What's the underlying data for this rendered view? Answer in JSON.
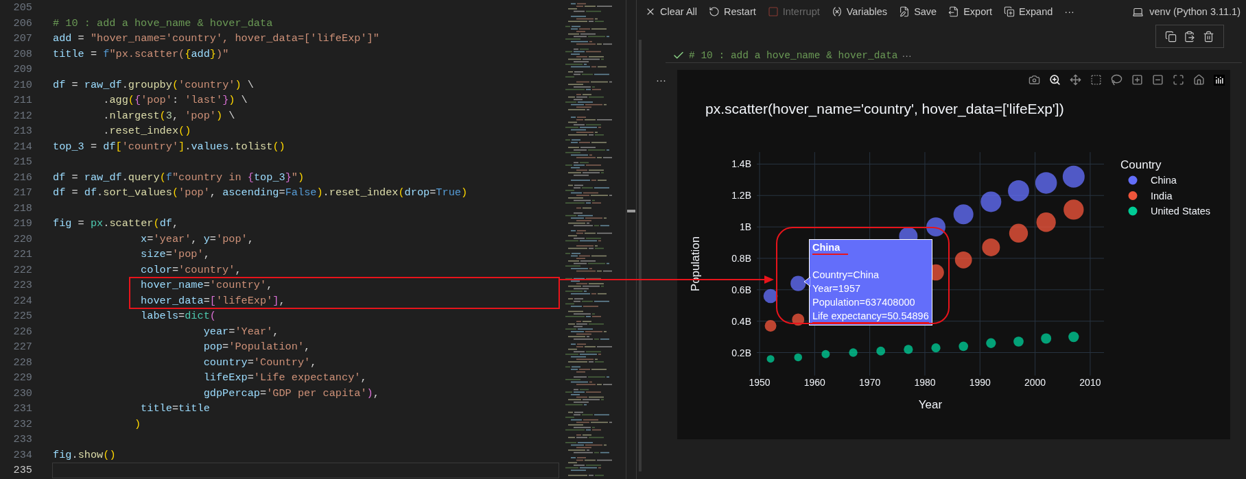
{
  "editor": {
    "lines": [
      {
        "number": "205",
        "current": false,
        "boxed": false
      },
      {
        "number": "206",
        "current": false,
        "boxed": false,
        "tokens": [
          {
            "text": "# 10 : add a hove_name & hover_data",
            "kind": "comment"
          }
        ]
      },
      {
        "number": "207",
        "current": false,
        "boxed": false,
        "tokens": [
          {
            "text": "add",
            "kind": "var"
          },
          {
            "text": " = ",
            "kind": "punct"
          },
          {
            "text": "\"hover_name='country', hover_data=['lifeExp']\"",
            "kind": "str"
          }
        ]
      },
      {
        "number": "208",
        "current": false,
        "boxed": false,
        "tokens": [
          {
            "text": "title",
            "kind": "var"
          },
          {
            "text": " = ",
            "kind": "punct"
          },
          {
            "text": "f",
            "kind": "const"
          },
          {
            "text": "\"px.scatter(",
            "kind": "str"
          },
          {
            "text": "{",
            "kind": "bracket1"
          },
          {
            "text": "add",
            "kind": "var"
          },
          {
            "text": "}",
            "kind": "bracket1"
          },
          {
            "text": ")\"",
            "kind": "str"
          }
        ]
      },
      {
        "number": "209",
        "current": false,
        "boxed": false
      },
      {
        "number": "210",
        "current": false,
        "boxed": false,
        "tokens": [
          {
            "text": "df",
            "kind": "var"
          },
          {
            "text": " = ",
            "kind": "punct"
          },
          {
            "text": "raw_df",
            "kind": "var"
          },
          {
            "text": ".",
            "kind": "punct"
          },
          {
            "text": "groupby",
            "kind": "func"
          },
          {
            "text": "(",
            "kind": "bracket1"
          },
          {
            "text": "'country'",
            "kind": "str"
          },
          {
            "text": ")",
            "kind": "bracket1"
          },
          {
            "text": " \\",
            "kind": "punct"
          }
        ]
      },
      {
        "number": "211",
        "current": false,
        "boxed": false,
        "tokens": [
          {
            "text": "        .",
            "kind": "punct"
          },
          {
            "text": "agg",
            "kind": "func"
          },
          {
            "text": "(",
            "kind": "bracket1"
          },
          {
            "text": "{",
            "kind": "bracket2"
          },
          {
            "text": "'pop'",
            "kind": "str"
          },
          {
            "text": ": ",
            "kind": "punct"
          },
          {
            "text": "'last'",
            "kind": "str"
          },
          {
            "text": "}",
            "kind": "bracket2"
          },
          {
            "text": ")",
            "kind": "bracket1"
          },
          {
            "text": " \\",
            "kind": "punct"
          }
        ]
      },
      {
        "number": "212",
        "current": false,
        "boxed": false,
        "tokens": [
          {
            "text": "        .",
            "kind": "punct"
          },
          {
            "text": "nlargest",
            "kind": "func"
          },
          {
            "text": "(",
            "kind": "bracket1"
          },
          {
            "text": "3",
            "kind": "number"
          },
          {
            "text": ", ",
            "kind": "punct"
          },
          {
            "text": "'pop'",
            "kind": "str"
          },
          {
            "text": ")",
            "kind": "bracket1"
          },
          {
            "text": " \\",
            "kind": "punct"
          }
        ]
      },
      {
        "number": "213",
        "current": false,
        "boxed": false,
        "tokens": [
          {
            "text": "        .",
            "kind": "punct"
          },
          {
            "text": "reset_index",
            "kind": "func"
          },
          {
            "text": "()",
            "kind": "bracket1"
          }
        ]
      },
      {
        "number": "214",
        "current": false,
        "boxed": false,
        "tokens": [
          {
            "text": "top_3",
            "kind": "var"
          },
          {
            "text": " = ",
            "kind": "punct"
          },
          {
            "text": "df",
            "kind": "var"
          },
          {
            "text": "[",
            "kind": "bracket1"
          },
          {
            "text": "'country'",
            "kind": "str"
          },
          {
            "text": "]",
            "kind": "bracket1"
          },
          {
            "text": ".",
            "kind": "punct"
          },
          {
            "text": "values",
            "kind": "var"
          },
          {
            "text": ".",
            "kind": "punct"
          },
          {
            "text": "tolist",
            "kind": "func"
          },
          {
            "text": "()",
            "kind": "bracket1"
          }
        ]
      },
      {
        "number": "215",
        "current": false,
        "boxed": false
      },
      {
        "number": "216",
        "current": false,
        "boxed": false,
        "tokens": [
          {
            "text": "df",
            "kind": "var"
          },
          {
            "text": " = ",
            "kind": "punct"
          },
          {
            "text": "raw_df",
            "kind": "var"
          },
          {
            "text": ".",
            "kind": "punct"
          },
          {
            "text": "query",
            "kind": "func"
          },
          {
            "text": "(",
            "kind": "bracket1"
          },
          {
            "text": "f",
            "kind": "const"
          },
          {
            "text": "\"country in ",
            "kind": "str"
          },
          {
            "text": "{",
            "kind": "bracket2"
          },
          {
            "text": "top_3",
            "kind": "var"
          },
          {
            "text": "}",
            "kind": "bracket2"
          },
          {
            "text": "\"",
            "kind": "str"
          },
          {
            "text": ")",
            "kind": "bracket1"
          }
        ]
      },
      {
        "number": "217",
        "current": false,
        "boxed": false,
        "tokens": [
          {
            "text": "df",
            "kind": "var"
          },
          {
            "text": " = ",
            "kind": "punct"
          },
          {
            "text": "df",
            "kind": "var"
          },
          {
            "text": ".",
            "kind": "punct"
          },
          {
            "text": "sort_values",
            "kind": "func"
          },
          {
            "text": "(",
            "kind": "bracket1"
          },
          {
            "text": "'pop'",
            "kind": "str"
          },
          {
            "text": ", ",
            "kind": "punct"
          },
          {
            "text": "ascending",
            "kind": "var"
          },
          {
            "text": "=",
            "kind": "punct"
          },
          {
            "text": "False",
            "kind": "const"
          },
          {
            "text": ")",
            "kind": "bracket1"
          },
          {
            "text": ".",
            "kind": "punct"
          },
          {
            "text": "reset_index",
            "kind": "func"
          },
          {
            "text": "(",
            "kind": "bracket1"
          },
          {
            "text": "drop",
            "kind": "var"
          },
          {
            "text": "=",
            "kind": "punct"
          },
          {
            "text": "True",
            "kind": "const"
          },
          {
            "text": ")",
            "kind": "bracket1"
          }
        ]
      },
      {
        "number": "218",
        "current": false,
        "boxed": false
      },
      {
        "number": "219",
        "current": false,
        "boxed": false,
        "tokens": [
          {
            "text": "fig",
            "kind": "var"
          },
          {
            "text": " = ",
            "kind": "punct"
          },
          {
            "text": "px",
            "kind": "module"
          },
          {
            "text": ".",
            "kind": "punct"
          },
          {
            "text": "scatter",
            "kind": "func"
          },
          {
            "text": "(",
            "kind": "bracket1"
          },
          {
            "text": "df",
            "kind": "var"
          },
          {
            "text": ",",
            "kind": "punct"
          }
        ]
      },
      {
        "number": "220",
        "current": false,
        "boxed": false,
        "tokens": [
          {
            "text": "              x",
            "kind": "var"
          },
          {
            "text": "=",
            "kind": "punct"
          },
          {
            "text": "'year'",
            "kind": "str"
          },
          {
            "text": ", ",
            "kind": "punct"
          },
          {
            "text": "y",
            "kind": "var"
          },
          {
            "text": "=",
            "kind": "punct"
          },
          {
            "text": "'pop'",
            "kind": "str"
          },
          {
            "text": ",",
            "kind": "punct"
          }
        ]
      },
      {
        "number": "221",
        "current": false,
        "boxed": false,
        "tokens": [
          {
            "text": "              size",
            "kind": "var"
          },
          {
            "text": "=",
            "kind": "punct"
          },
          {
            "text": "'pop'",
            "kind": "str"
          },
          {
            "text": ",",
            "kind": "punct"
          }
        ]
      },
      {
        "number": "222",
        "current": false,
        "boxed": false,
        "tokens": [
          {
            "text": "              color",
            "kind": "var"
          },
          {
            "text": "=",
            "kind": "punct"
          },
          {
            "text": "'country'",
            "kind": "str"
          },
          {
            "text": ",",
            "kind": "punct"
          }
        ]
      },
      {
        "number": "223",
        "current": false,
        "boxed": true,
        "tokens": [
          {
            "text": "              hover_name",
            "kind": "var"
          },
          {
            "text": "=",
            "kind": "punct"
          },
          {
            "text": "'country'",
            "kind": "str"
          },
          {
            "text": ",",
            "kind": "punct"
          }
        ]
      },
      {
        "number": "224",
        "current": false,
        "boxed": true,
        "tokens": [
          {
            "text": "              hover_data",
            "kind": "var"
          },
          {
            "text": "=",
            "kind": "punct"
          },
          {
            "text": "[",
            "kind": "bracket2"
          },
          {
            "text": "'lifeExp'",
            "kind": "str"
          },
          {
            "text": "]",
            "kind": "bracket2"
          },
          {
            "text": ",",
            "kind": "punct"
          }
        ]
      },
      {
        "number": "225",
        "current": false,
        "boxed": false,
        "tokens": [
          {
            "text": "              labels",
            "kind": "var"
          },
          {
            "text": "=",
            "kind": "punct"
          },
          {
            "text": "dict",
            "kind": "module"
          },
          {
            "text": "(",
            "kind": "bracket2"
          }
        ]
      },
      {
        "number": "226",
        "current": false,
        "boxed": false,
        "tokens": [
          {
            "text": "                        year",
            "kind": "var"
          },
          {
            "text": "=",
            "kind": "punct"
          },
          {
            "text": "'Year'",
            "kind": "str"
          },
          {
            "text": ",",
            "kind": "punct"
          }
        ]
      },
      {
        "number": "227",
        "current": false,
        "boxed": false,
        "tokens": [
          {
            "text": "                        pop",
            "kind": "var"
          },
          {
            "text": "=",
            "kind": "punct"
          },
          {
            "text": "'Population'",
            "kind": "str"
          },
          {
            "text": ",",
            "kind": "punct"
          }
        ]
      },
      {
        "number": "228",
        "current": false,
        "boxed": false,
        "tokens": [
          {
            "text": "                        country",
            "kind": "var"
          },
          {
            "text": "=",
            "kind": "punct"
          },
          {
            "text": "'Country'",
            "kind": "str"
          },
          {
            "text": ",",
            "kind": "punct"
          }
        ]
      },
      {
        "number": "229",
        "current": false,
        "boxed": false,
        "tokens": [
          {
            "text": "                        lifeExp",
            "kind": "var"
          },
          {
            "text": "=",
            "kind": "punct"
          },
          {
            "text": "'Life expectancy'",
            "kind": "str"
          },
          {
            "text": ",",
            "kind": "punct"
          }
        ]
      },
      {
        "number": "230",
        "current": false,
        "boxed": false,
        "tokens": [
          {
            "text": "                        gdpPercap",
            "kind": "var"
          },
          {
            "text": "=",
            "kind": "punct"
          },
          {
            "text": "'GDP per capita'",
            "kind": "str"
          },
          {
            "text": ")",
            "kind": "bracket2"
          },
          {
            "text": ",",
            "kind": "punct"
          }
        ]
      },
      {
        "number": "231",
        "current": false,
        "boxed": false,
        "tokens": [
          {
            "text": "              title",
            "kind": "var"
          },
          {
            "text": "=",
            "kind": "punct"
          },
          {
            "text": "title",
            "kind": "var"
          }
        ]
      },
      {
        "number": "232",
        "current": false,
        "boxed": false,
        "tokens": [
          {
            "text": "             )",
            "kind": "bracket1"
          }
        ]
      },
      {
        "number": "233",
        "current": false,
        "boxed": false
      },
      {
        "number": "234",
        "current": false,
        "boxed": false,
        "tokens": [
          {
            "text": "fig",
            "kind": "var"
          },
          {
            "text": ".",
            "kind": "punct"
          },
          {
            "text": "show",
            "kind": "func"
          },
          {
            "text": "()",
            "kind": "bracket1"
          }
        ]
      },
      {
        "number": "235",
        "current": true,
        "boxed": false
      }
    ]
  },
  "toolbar": {
    "buttons": [
      {
        "kind": "clear",
        "label": "Clear All",
        "disabled": false
      },
      {
        "kind": "restart",
        "label": "Restart",
        "disabled": false
      },
      {
        "kind": "interrupt",
        "label": "Interrupt",
        "disabled": true
      },
      {
        "kind": "variables",
        "label": "Variables",
        "disabled": false
      },
      {
        "kind": "save",
        "label": "Save",
        "disabled": false
      },
      {
        "kind": "export",
        "label": "Export",
        "disabled": false
      },
      {
        "kind": "expand",
        "label": "Expand",
        "disabled": false
      },
      {
        "kind": "more",
        "label": "···",
        "disabled": false
      }
    ],
    "kernel": "venv (Python 3.11.1)"
  },
  "cell": {
    "succeeded": true,
    "summary": "# 10 : add a hove_name & hover_data",
    "summary_more": "···",
    "output_menu": "···"
  },
  "plot": {
    "chart_data": {
      "type": "scatter",
      "title": "px.scatter(hover_name='country', hover_data=['lifeExp'])",
      "xlabel": "Year",
      "ylabel": "Population",
      "x": [
        1952,
        1957,
        1962,
        1967,
        1972,
        1977,
        1982,
        1987,
        1992,
        1997,
        2002,
        2007
      ],
      "series": [
        {
          "name": "China",
          "color": "#636efa",
          "values": [
            560000000,
            640000000,
            null,
            null,
            null,
            940000000,
            1000000000,
            1080000000,
            1160000000,
            1230000000,
            1280000000,
            1320000000
          ],
          "sizes": [
            0.42,
            0.48,
            null,
            null,
            null,
            0.71,
            0.76,
            0.82,
            0.88,
            0.93,
            0.97,
            1
          ]
        },
        {
          "name": "India",
          "color": "#ef553b",
          "values": [
            370000000,
            410000000,
            null,
            null,
            null,
            null,
            710000000,
            790000000,
            870000000,
            960000000,
            1030000000,
            1110000000
          ],
          "sizes": [
            0.28,
            0.31,
            null,
            null,
            null,
            null,
            0.54,
            0.6,
            0.66,
            0.73,
            0.78,
            0.84
          ]
        },
        {
          "name": "United States",
          "color": "#00cc96",
          "values": [
            160000000,
            170000000,
            190000000,
            200000000,
            210000000,
            220000000,
            230000000,
            240000000,
            260000000,
            270000000,
            290000000,
            300000000
          ],
          "sizes": [
            0.12,
            0.13,
            0.14,
            0.15,
            0.16,
            0.17,
            0.17,
            0.18,
            0.2,
            0.21,
            0.22,
            0.23
          ]
        }
      ],
      "xlim": [
        1949.5,
        2012.5
      ],
      "ylim": [
        54000000,
        1476000000
      ],
      "xticks": [
        1950,
        1960,
        1970,
        1980,
        1990,
        2000,
        2010
      ],
      "yticks": [
        {
          "value": 200000000,
          "label": "0.2B"
        },
        {
          "value": 400000000,
          "label": "0.4B"
        },
        {
          "value": 600000000,
          "label": "0.6B"
        },
        {
          "value": 800000000,
          "label": "0.8B"
        },
        {
          "value": 1000000000,
          "label": "1B"
        },
        {
          "value": 1200000000,
          "label": "1.2B"
        },
        {
          "value": 1400000000,
          "label": "1.4B"
        }
      ],
      "grid": true,
      "legend": {
        "title": "Country"
      }
    },
    "hover_label": {
      "framed": true,
      "title": {
        "text": "China",
        "underlined": true
      },
      "lines": [
        {
          "text": "Country=China",
          "underlined": false
        },
        {
          "text": "Year=1957",
          "underlined": false
        },
        {
          "text": "Population=637408000",
          "underlined": false
        },
        {
          "text": "Life expectancy=50.54896",
          "underlined": true
        }
      ]
    }
  }
}
